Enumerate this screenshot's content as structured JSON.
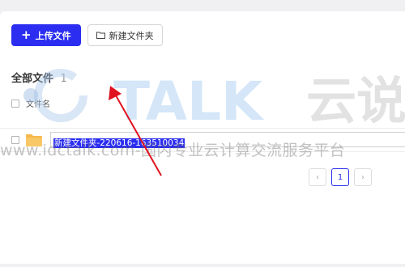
{
  "toolbar": {
    "upload_label": "上传文件",
    "new_folder_label": "新建文件夹"
  },
  "section": {
    "title": "全部文件",
    "count": "1"
  },
  "table": {
    "name_header": "文件名"
  },
  "file_row": {
    "name_value": "新建文件夹-220616-163510034"
  },
  "pagination": {
    "prev": "‹",
    "current": "1",
    "next": "›"
  },
  "watermark": {
    "brand": "TALK",
    "brand_cn": "云说",
    "url_text": "www.idctalk.com-国内专业云计算交流服务平台"
  },
  "colors": {
    "primary": "#2b2ef0",
    "annotation_arrow": "#e0121f"
  }
}
